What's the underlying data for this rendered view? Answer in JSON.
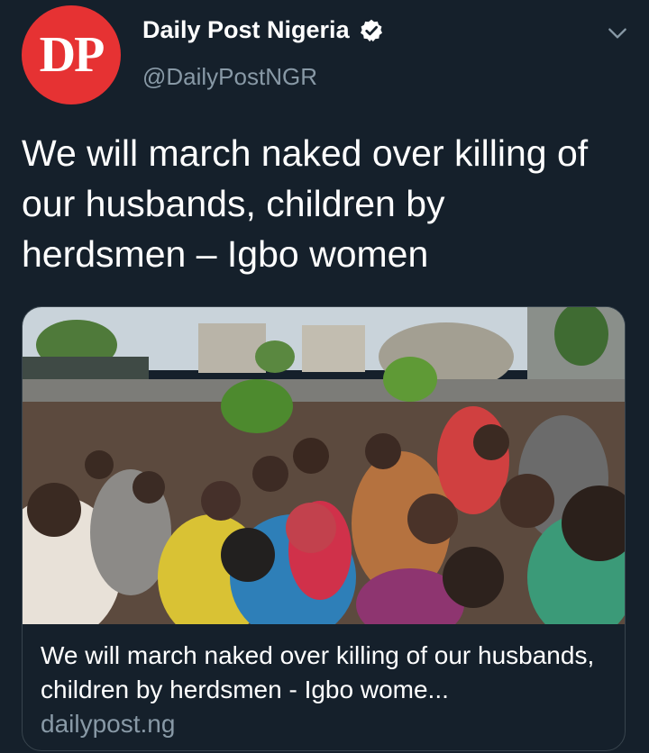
{
  "account": {
    "avatar_text": "DP",
    "display_name": "Daily Post Nigeria",
    "handle": "@DailyPostNGR",
    "verified": true,
    "avatar_color": "#e63233"
  },
  "tweet": {
    "text": "We will march naked over killing of our husbands, children by herdsmen – Igbo women"
  },
  "card": {
    "title": "We will march naked over killing of our husbands, children by herdsmen - Igbo wome...",
    "domain": "dailypost.ng"
  },
  "icons": {
    "verified": "verified-badge-icon",
    "menu": "chevron-down-icon"
  },
  "colors": {
    "background": "#15202b",
    "secondary_text": "#8899a6",
    "border": "#38444d",
    "verified_bg": "#ffffff"
  }
}
